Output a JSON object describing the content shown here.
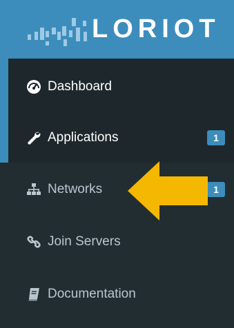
{
  "brand": {
    "name": "LORIOT",
    "color": "#3c8dbc"
  },
  "menu": {
    "items": [
      {
        "label": "Dashboard",
        "icon": "dashboard-icon",
        "badge": null,
        "state": "active"
      },
      {
        "label": "Applications",
        "icon": "wrench-icon",
        "badge": "1",
        "state": "active"
      },
      {
        "label": "Networks",
        "icon": "sitemap-icon",
        "badge": "1",
        "state": "normal"
      },
      {
        "label": "Join Servers",
        "icon": "link-icon",
        "badge": null,
        "state": "normal"
      },
      {
        "label": "Documentation",
        "icon": "book-icon",
        "badge": null,
        "state": "normal"
      }
    ]
  },
  "annotation": {
    "icon": "arrow-left-icon",
    "color": "#f5b800",
    "points_to": "Networks"
  },
  "colors": {
    "sidebar_bg": "#222d32",
    "active_bg": "#1e282c",
    "text_muted": "#b8c7ce",
    "text_active": "#ffffff"
  }
}
